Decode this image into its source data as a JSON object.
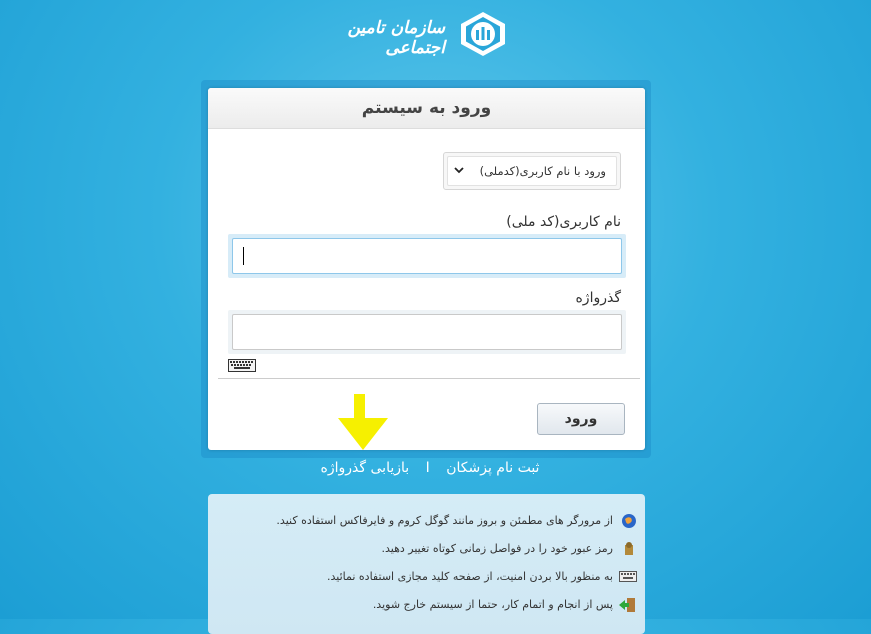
{
  "header": {
    "org_name": "سازمان تامین اجتماعی"
  },
  "login": {
    "title": "ورود به سیستم",
    "method_select": "ورود با نام کاربری(کدملی)",
    "username_label": "نام کاربری(کد ملی)",
    "password_label": "گذرواژه",
    "submit_label": "ورود"
  },
  "links": {
    "register": "ثبت نام پزشکان",
    "separator": "I",
    "recover": "بازیابی گذرواژه"
  },
  "tips": [
    "از مرورگر های مطمئن و بروز مانند گوگل کروم و فایرفاکس استفاده کنید.",
    "رمز عبور خود را در فواصل زمانی کوتاه تغییر دهید.",
    "به منظور بالا بردن امنیت، از صفحه کلید مجازی استفاده نمائید.",
    "پس از انجام و اتمام کار، حتما از سیستم خارج شوید."
  ],
  "colors": {
    "background": "#33b1e0",
    "arrow": "#f6f000",
    "panel": "#ffffff"
  }
}
